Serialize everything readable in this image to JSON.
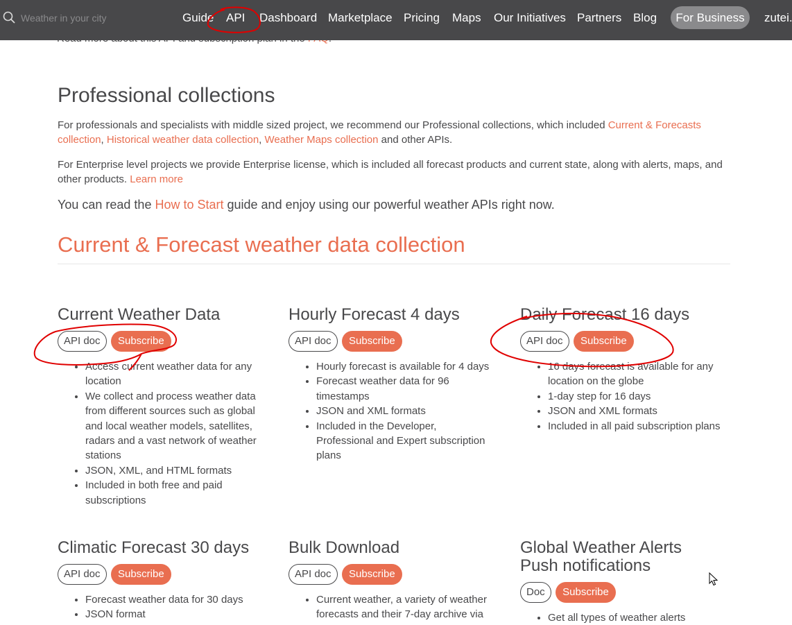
{
  "nav": {
    "search_placeholder": "Weather in your city",
    "items": [
      "Guide",
      "API",
      "Dashboard",
      "Marketplace",
      "Pricing",
      "Maps",
      "Our Initiatives",
      "Partners",
      "Blog"
    ],
    "business": "For Business",
    "user": "zutei."
  },
  "behind_text": {
    "before": "Read more about this API and subscription plan in the ",
    "link": "FAQ",
    "after": "."
  },
  "professional": {
    "title": "Professional collections",
    "p1_before": "For professionals and specialists with middle sized project, we recommend our Professional collections, which included ",
    "p1_link1": "Current & Forecasts collection",
    "p1_sep1": ", ",
    "p1_link2": "Historical weather data collection",
    "p1_sep2": ", ",
    "p1_link3": "Weather Maps collection",
    "p1_after": " and other APIs.",
    "p2_before": "For Enterprise level projects we provide Enterprise license, which is included all forecast products and current state, along with alerts, maps, and other products. ",
    "p2_link": "Learn more",
    "p3_before": "You can read the ",
    "p3_link": "How to Start",
    "p3_after": " guide and enjoy using our powerful weather APIs right now."
  },
  "section": {
    "title": "Current & Forecast weather data collection"
  },
  "cards": [
    {
      "title": "Current Weather Data",
      "doc_label": "API doc",
      "subscribe_label": "Subscribe",
      "bullets": [
        "Access current weather data for any location",
        "We collect and process weather data from different sources such as global and local weather models, satellites, radars and a vast network of weather stations",
        "JSON, XML, and HTML formats",
        "Included in both free and paid subscriptions"
      ]
    },
    {
      "title": "Hourly Forecast 4 days",
      "doc_label": "API doc",
      "subscribe_label": "Subscribe",
      "bullets": [
        "Hourly forecast is available for 4 days",
        "Forecast weather data for 96 timestamps",
        "JSON and XML formats",
        "Included in the Developer, Professional and Expert subscription plans"
      ]
    },
    {
      "title": "Daily Forecast 16 days",
      "doc_label": "API doc",
      "subscribe_label": "Subscribe",
      "bullets": [
        "16 days forecast is available for any location on the globe",
        "1-day step for 16 days",
        "JSON and XML formats",
        "Included in all paid subscription plans"
      ]
    },
    {
      "title": "Climatic Forecast 30 days",
      "doc_label": "API doc",
      "subscribe_label": "Subscribe",
      "bullets": [
        "Forecast weather data for 30 days",
        "JSON format"
      ]
    },
    {
      "title": "Bulk Download",
      "doc_label": "API doc",
      "subscribe_label": "Subscribe",
      "bullets": [
        "Current weather, a variety of weather forecasts and their 7-day archive via"
      ]
    },
    {
      "title": "Global Weather Alerts Push notifications",
      "doc_label": "Doc",
      "subscribe_label": "Subscribe",
      "bullets": [
        "Get all types of weather alerts"
      ]
    }
  ],
  "colors": {
    "topbar": "#48484a",
    "accent": "#e96e50",
    "text": "#48484a",
    "annotation": "#e00000"
  }
}
